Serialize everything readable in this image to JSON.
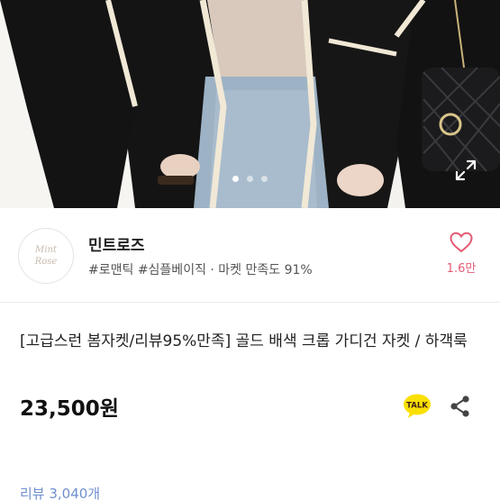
{
  "photo": {
    "slide_count": 3,
    "active_index": 0,
    "expand_icon": "expand-icon"
  },
  "shop": {
    "logo_line1": "Mint",
    "logo_line2": "Rose",
    "name": "민트로즈",
    "tags": "#로맨틱 #심플베이직 · 마켓 만족도 91%",
    "like_count": "1.6만",
    "like_icon": "heart-icon"
  },
  "product": {
    "title": "[고급스런 봄자켓/리뷰95%만족] 골드 배색 크롭 가디건 자켓 / 하객룩",
    "price": "23,500원",
    "talk_label": "TALK",
    "share_icon": "share-icon"
  },
  "reviews": {
    "label": "리뷰 3,040개"
  },
  "colors": {
    "accent_pink": "#e55b73",
    "link_blue": "#6f8fcf",
    "talk_yellow": "#f9e000"
  }
}
